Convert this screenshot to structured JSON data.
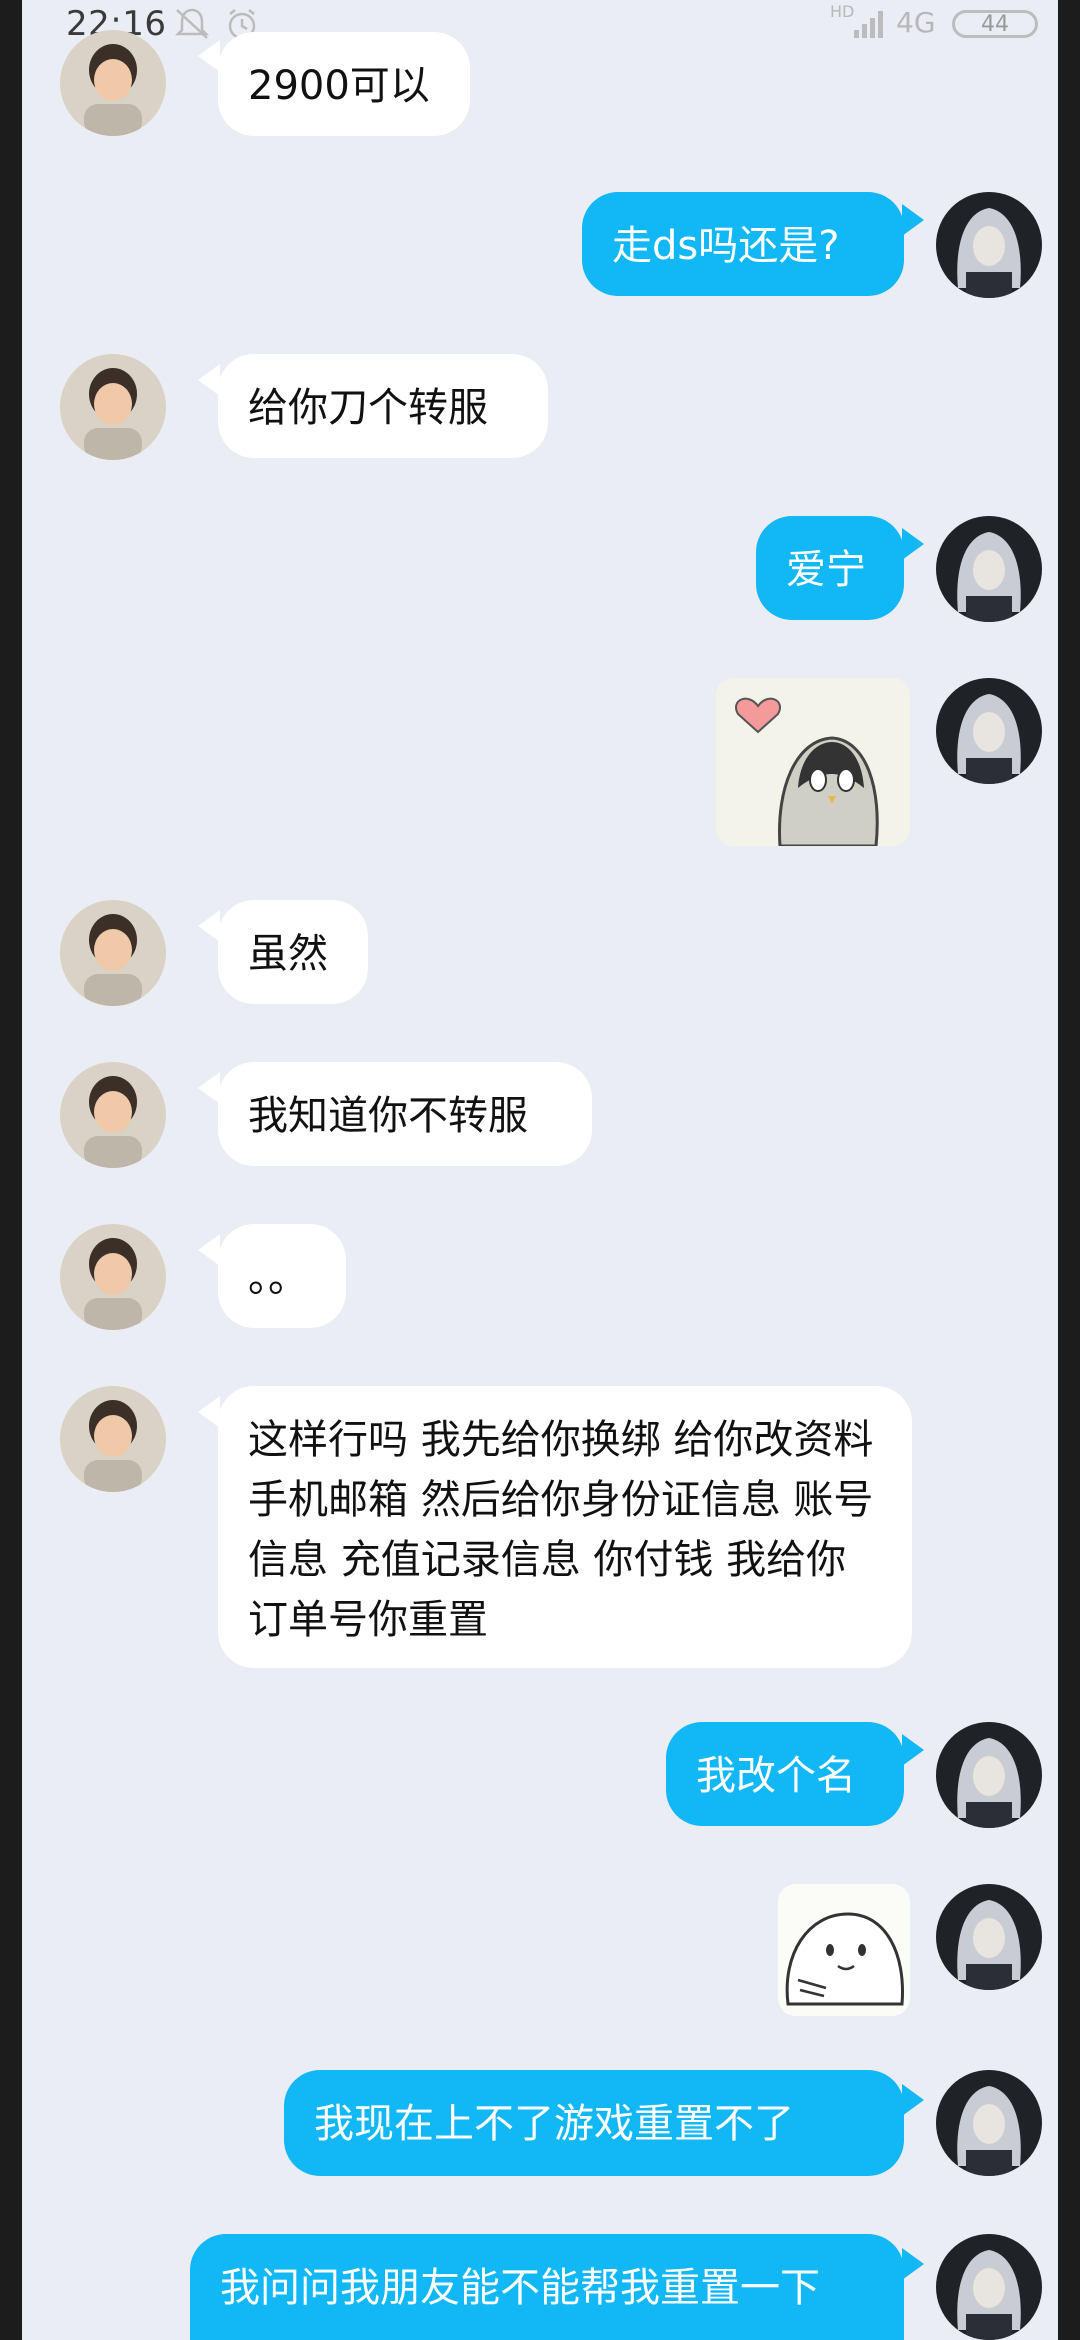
{
  "status_bar": {
    "time": "22:16",
    "network": "4G",
    "hd": "HD",
    "battery": "44"
  },
  "messages": [
    {
      "side": "left",
      "text": "2900可以"
    },
    {
      "side": "right",
      "text": "走ds吗还是?"
    },
    {
      "side": "left",
      "text": "给你刀个转服"
    },
    {
      "side": "right",
      "text": "爱宁"
    },
    {
      "side": "right",
      "sticker": "penguin-heart-sticker"
    },
    {
      "side": "left",
      "text": "虽然"
    },
    {
      "side": "left",
      "text": "我知道你不转服"
    },
    {
      "side": "left",
      "text": "。。"
    },
    {
      "side": "left",
      "text": "这样行吗 我先给你换绑 给你改资料 手机邮箱 然后给你身份证信息 账号信息 充值记录信息 你付钱 我给你订单号你重置"
    },
    {
      "side": "right",
      "text": "我改个名"
    },
    {
      "side": "right",
      "sticker": "blob-sticker"
    },
    {
      "side": "right",
      "text": "我现在上不了游戏重置不了"
    },
    {
      "side": "right",
      "text": "我问问我朋友能不能帮我重置一下"
    }
  ],
  "colors": {
    "background": "#ebedf4",
    "bubble_right": "#12b7f5",
    "bubble_left": "#ffffff"
  }
}
